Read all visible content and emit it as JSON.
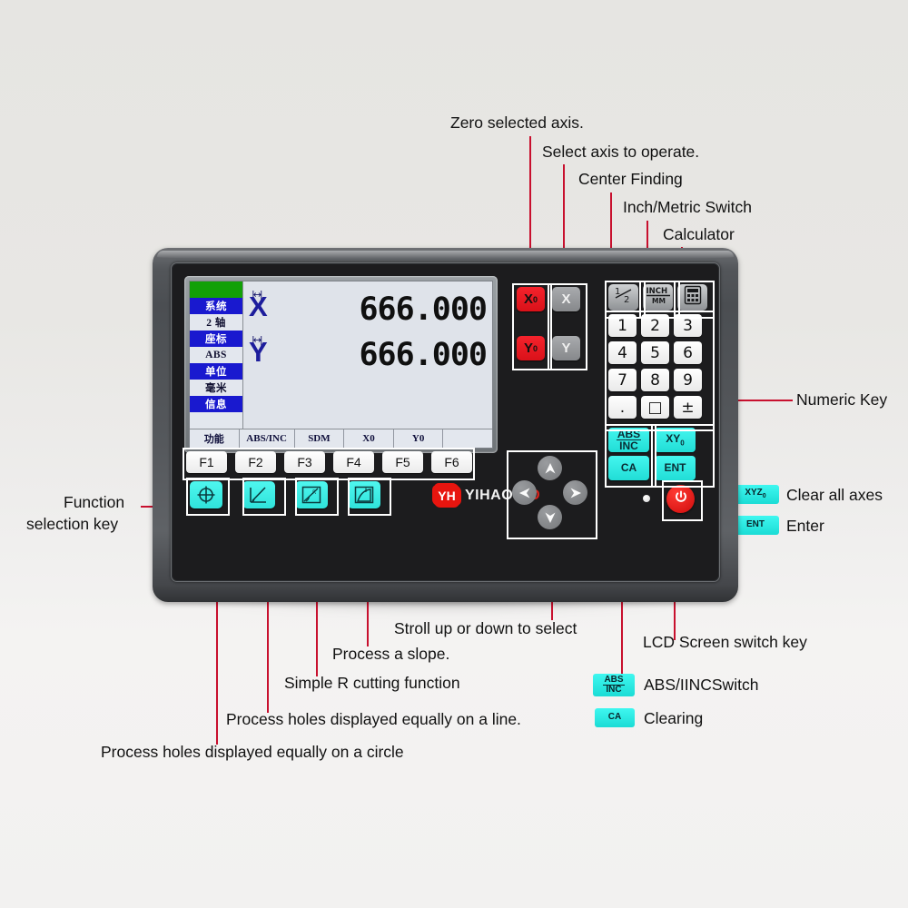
{
  "annotations": {
    "zero_axis": "Zero selected axis.",
    "select_axis": "Select axis to operate.",
    "center_finding": "Center Finding",
    "inch_metric": "Inch/Metric Switch",
    "calculator": "Calculator",
    "numeric_key": "Numeric Key",
    "function_selection_line1": "Function",
    "function_selection_line2": "selection key",
    "stroll": "Stroll up or down to select",
    "process_slope": "Process a slope.",
    "simple_r": "Simple R cutting function",
    "holes_line": "Process holes displayed equally on a line.",
    "holes_circle": "Process holes displayed equally on a circle",
    "lcd_switch": "LCD Screen switch key",
    "clear_all_axes": "Clear all axes",
    "enter": "Enter",
    "abs_inc_switch": "ABS/IINCSwitch",
    "clearing": "Clearing"
  },
  "lcd": {
    "status_cells": [
      {
        "label": "",
        "style": "green"
      },
      {
        "label": "系统",
        "style": "blue"
      },
      {
        "label": "2 轴",
        "style": "pale"
      },
      {
        "label": "座标",
        "style": "blue"
      },
      {
        "label": "ABS",
        "style": "pale"
      },
      {
        "label": "单位",
        "style": "blue"
      },
      {
        "label": "毫米",
        "style": "pale"
      },
      {
        "label": "信息",
        "style": "blue"
      },
      {
        "label": "",
        "style": "blank"
      }
    ],
    "axes": [
      {
        "name": "X",
        "value": "666.000"
      },
      {
        "name": "Y",
        "value": "666.000"
      }
    ],
    "softkeys": [
      "功能",
      "ABS/INC",
      "SDM",
      "X0",
      "Y0",
      ""
    ]
  },
  "panel": {
    "fkeys": [
      "F1",
      "F2",
      "F3",
      "F4",
      "F5",
      "F6"
    ],
    "icon_keys": [
      {
        "icon": "bolt-circle-icon",
        "name": "bolt-circle-key"
      },
      {
        "icon": "line-hole-icon",
        "name": "line-hole-key"
      },
      {
        "icon": "angle-slope-icon",
        "name": "angle-slope-key"
      },
      {
        "icon": "r-cut-icon",
        "name": "r-cut-key"
      }
    ],
    "axis_keys": [
      {
        "label": "X",
        "sub": "0",
        "style": "red",
        "name": "x-zero-key"
      },
      {
        "label": "X",
        "sub": "",
        "style": "gray",
        "name": "x-select-key"
      },
      {
        "label": "Y",
        "sub": "0",
        "style": "red",
        "name": "y-zero-key"
      },
      {
        "label": "Y",
        "sub": "",
        "style": "gray",
        "name": "y-select-key"
      }
    ],
    "top_keys": [
      {
        "label": "1/2",
        "name": "half-key"
      },
      {
        "label": "INCH/MM",
        "name": "inch-mm-key"
      },
      {
        "label": "calculator",
        "name": "calculator-key"
      }
    ],
    "numpad": [
      "1",
      "2",
      "3",
      "4",
      "5",
      "6",
      "7",
      "8",
      "9",
      ".",
      "□",
      "±"
    ],
    "cmd_keys": [
      {
        "line1": "ABS",
        "line2": "INC",
        "name": "abs-inc-key"
      },
      {
        "line1": "XY",
        "sub": "0",
        "name": "xy-zero-key"
      },
      {
        "line1": "CA",
        "name": "ca-key"
      },
      {
        "line1": "ENT",
        "name": "ent-key"
      }
    ],
    "dpad": [
      "up",
      "left",
      "right",
      "down"
    ]
  },
  "logo": {
    "badge": "YH",
    "word1": "YIHAO",
    "word2": "GD"
  },
  "legend": [
    {
      "chip_line1": "XYZ",
      "chip_sub": "0",
      "label": "Clear all axes",
      "name": "legend-xyz"
    },
    {
      "chip_line1": "ENT",
      "label": "Enter",
      "name": "legend-ent"
    },
    {
      "chip_line1": "ABS",
      "chip_line2": "INC",
      "label": "ABS/IINCSwitch",
      "name": "legend-abs-inc"
    },
    {
      "chip_line1": "CA",
      "label": "Clearing",
      "name": "legend-ca"
    }
  ],
  "colors": {
    "accent_red": "#c8102e",
    "key_red": "#e8150f",
    "key_cyan": "#2fe3db",
    "lcd_blue": "#1919cf",
    "lcd_green": "#12a007"
  }
}
